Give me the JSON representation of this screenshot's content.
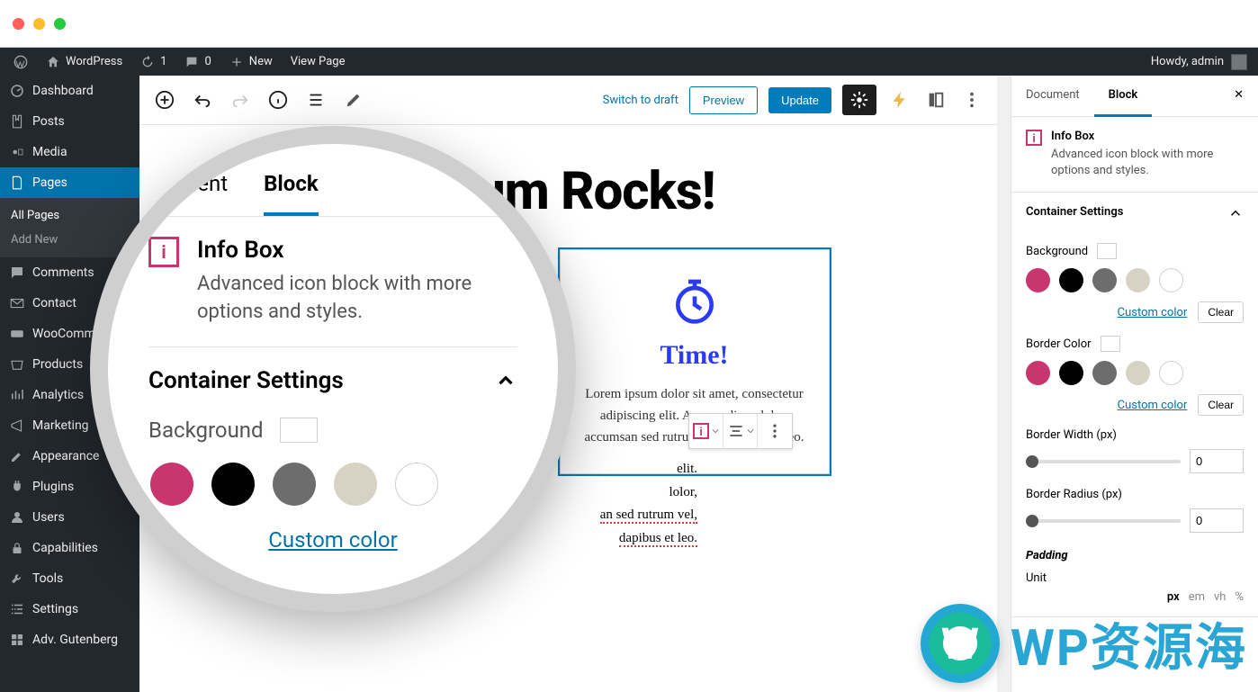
{
  "mac": {
    "close": "close",
    "min": "minimize",
    "max": "maximize"
  },
  "adminbar": {
    "site_name": "WordPress",
    "updates": "1",
    "comments": "0",
    "new": "New",
    "view_page": "View Page",
    "howdy": "Howdy, admin"
  },
  "sidebar": {
    "items": [
      {
        "label": "Dashboard",
        "icon": "dashboard"
      },
      {
        "label": "Posts",
        "icon": "pin"
      },
      {
        "label": "Media",
        "icon": "media"
      },
      {
        "label": "Pages",
        "icon": "page",
        "active": true
      },
      {
        "label": "Comments",
        "icon": "comment"
      },
      {
        "label": "Contact",
        "icon": "mail"
      },
      {
        "label": "WooComme…",
        "icon": "woo"
      },
      {
        "label": "Products",
        "icon": "box"
      },
      {
        "label": "Analytics",
        "icon": "chart"
      },
      {
        "label": "Marketing",
        "icon": "megaphone"
      },
      {
        "label": "Appearance",
        "icon": "brush"
      },
      {
        "label": "Plugins",
        "icon": "plug"
      },
      {
        "label": "Users",
        "icon": "user"
      },
      {
        "label": "Capabilities",
        "icon": "lock"
      },
      {
        "label": "Tools",
        "icon": "wrench"
      },
      {
        "label": "Settings",
        "icon": "gear"
      },
      {
        "label": "Adv. Gutenberg",
        "icon": "blocks"
      }
    ],
    "submenu": {
      "all_pages": "All Pages",
      "add_new": "Add New"
    }
  },
  "editor_header": {
    "switch_draft": "Switch to draft",
    "preview": "Preview",
    "update": "Update"
  },
  "canvas": {
    "title": "psum Rocks!",
    "infobox_right": {
      "heading": "Time!",
      "text": "Lorem ipsum dolor sit amet, consectetur adipiscing elit. Aenean diam dolor, accumsan sed rutrum vel, dapibus et leo."
    },
    "infobox_left_peek": {
      "frag1": "elit.",
      "frag2": "lolor,",
      "frag3": "an sed rutrum vel,",
      "frag4": "dapibus et leo."
    }
  },
  "inspector": {
    "tabs": {
      "document": "Document",
      "block": "Block"
    },
    "block_card": {
      "title": "Info Box",
      "desc": "Advanced icon block with more options and styles."
    },
    "container_settings": {
      "title": "Container Settings",
      "background_label": "Background",
      "border_color_label": "Border Color",
      "custom_color": "Custom color",
      "clear": "Clear",
      "border_width_label": "Border Width (px)",
      "border_width_value": "0",
      "border_radius_label": "Border Radius (px)",
      "border_radius_value": "0",
      "padding_label": "Padding",
      "unit_label": "Unit",
      "units": [
        "px",
        "em",
        "vh",
        "%"
      ]
    },
    "colors": [
      "#c9356e",
      "#000000",
      "#6d6d6d",
      "#d6d2c4",
      "#ffffff"
    ]
  },
  "magnifier": {
    "tabs": {
      "document": "ument",
      "block": "Block"
    },
    "card": {
      "title": "Info Box",
      "desc": "Advanced icon block with more options and styles."
    },
    "panel_title": "Container Settings",
    "background_label": "Background",
    "custom_color": "Custom color"
  },
  "watermark": {
    "text": "WP资源海"
  }
}
